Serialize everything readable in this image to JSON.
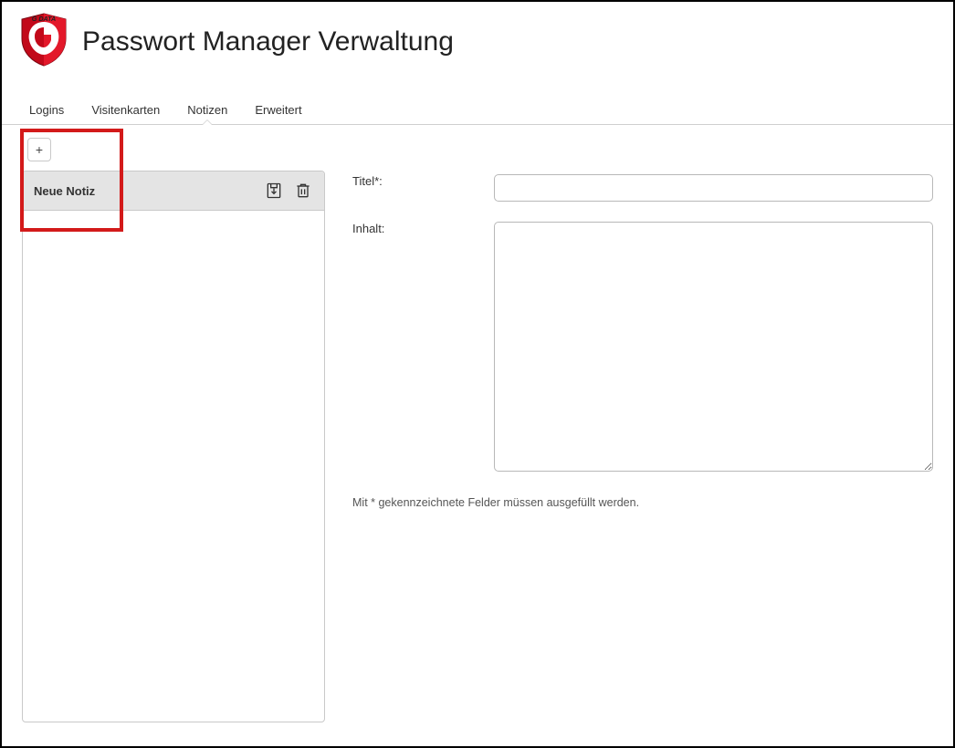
{
  "header": {
    "brand_text": "G DATA",
    "title": "Passwort Manager Verwaltung"
  },
  "tabs": [
    {
      "label": "Logins",
      "active": false
    },
    {
      "label": "Visitenkarten",
      "active": false
    },
    {
      "label": "Notizen",
      "active": true
    },
    {
      "label": "Erweitert",
      "active": false
    }
  ],
  "toolbar": {
    "add_symbol": "+"
  },
  "list": {
    "items": [
      {
        "label": "Neue Notiz"
      }
    ]
  },
  "detail": {
    "title_label": "Titel*:",
    "title_value": "",
    "content_label": "Inhalt:",
    "content_value": "",
    "hint": "Mit * gekennzeichnete Felder müssen ausgefüllt werden."
  },
  "icons": {
    "save": "save-icon",
    "delete": "trash-icon"
  }
}
